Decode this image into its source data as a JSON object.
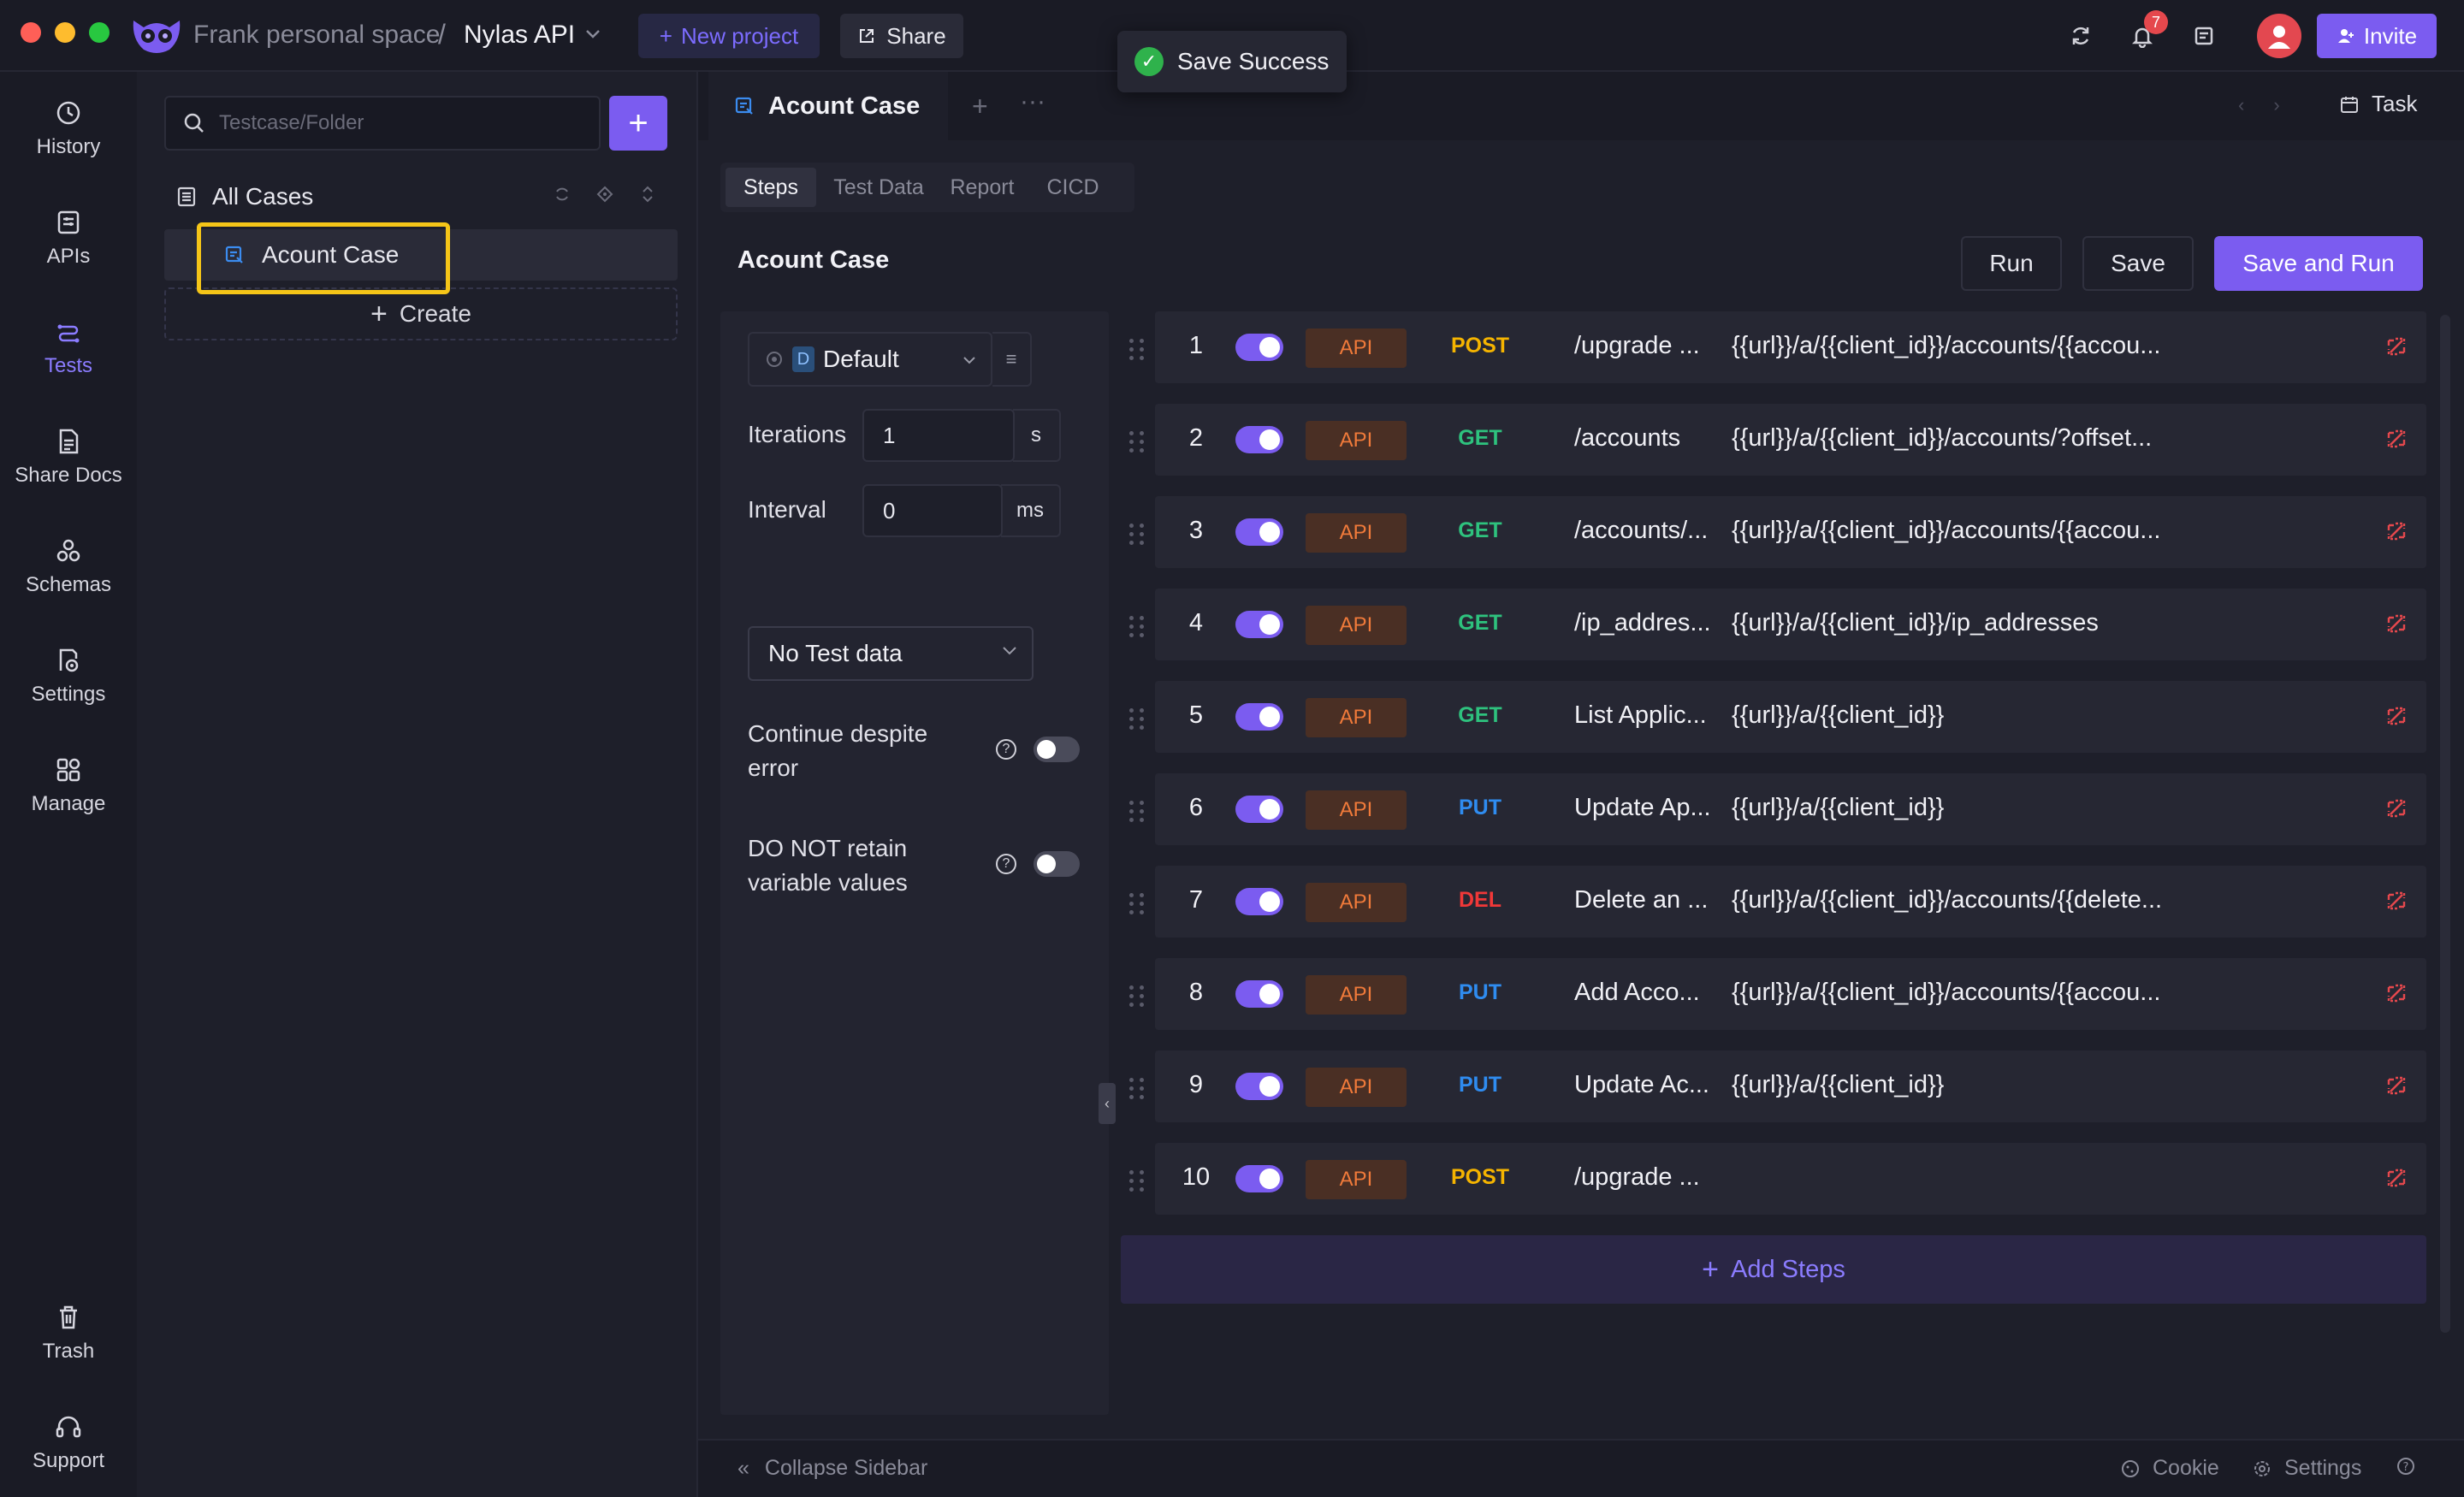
{
  "topbar": {
    "workspace": "Frank personal space",
    "separator": "/",
    "project": "Nylas API",
    "new_project": "New project",
    "share": "Share",
    "toast": "Save Success",
    "notification_count": "7",
    "invite": "Invite"
  },
  "nav": {
    "items": [
      {
        "label": "History",
        "icon": "history-icon"
      },
      {
        "label": "APIs",
        "icon": "apis-icon"
      },
      {
        "label": "Tests",
        "icon": "tests-icon"
      },
      {
        "label": "Share Docs",
        "icon": "share-docs-icon"
      },
      {
        "label": "Schemas",
        "icon": "schemas-icon"
      },
      {
        "label": "Settings",
        "icon": "settings-icon"
      },
      {
        "label": "Manage",
        "icon": "manage-icon"
      }
    ],
    "trash": "Trash",
    "support": "Support"
  },
  "cases": {
    "search_placeholder": "Testcase/Folder",
    "all_cases": "All Cases",
    "case_name": "Acount Case",
    "create": "Create"
  },
  "main": {
    "tab_title": "Acount Case",
    "task": "Task",
    "subtabs": [
      "Steps",
      "Test Data",
      "Report",
      "CICD"
    ],
    "title": "Acount Case",
    "run": "Run",
    "save": "Save",
    "save_and_run": "Save and Run",
    "settings": {
      "environment": "Default",
      "environment_badge": "D",
      "iterations_label": "Iterations",
      "iterations_value": "1",
      "iterations_unit": "s",
      "interval_label": "Interval",
      "interval_value": "0",
      "interval_unit": "ms",
      "test_data": "No Test data",
      "continue_label": "Continue despite error",
      "retain_label": "DO NOT retain variable values"
    },
    "steps": [
      {
        "num": "1",
        "badge": "API",
        "method": "POST",
        "name": "/upgrade ...",
        "url": "{{url}}/a/{{client_id}}/accounts/{{accou..."
      },
      {
        "num": "2",
        "badge": "API",
        "method": "GET",
        "name": "/accounts",
        "url": "{{url}}/a/{{client_id}}/accounts/?offset..."
      },
      {
        "num": "3",
        "badge": "API",
        "method": "GET",
        "name": "/accounts/...",
        "url": "{{url}}/a/{{client_id}}/accounts/{{accou..."
      },
      {
        "num": "4",
        "badge": "API",
        "method": "GET",
        "name": "/ip_addres...",
        "url": "{{url}}/a/{{client_id}}/ip_addresses"
      },
      {
        "num": "5",
        "badge": "API",
        "method": "GET",
        "name": "List Applic...",
        "url": "{{url}}/a/{{client_id}}"
      },
      {
        "num": "6",
        "badge": "API",
        "method": "PUT",
        "name": "Update Ap...",
        "url": "{{url}}/a/{{client_id}}"
      },
      {
        "num": "7",
        "badge": "API",
        "method": "DEL",
        "name": "Delete an ...",
        "url": "{{url}}/a/{{client_id}}/accounts/{{delete..."
      },
      {
        "num": "8",
        "badge": "API",
        "method": "PUT",
        "name": "Add Acco...",
        "url": "{{url}}/a/{{client_id}}/accounts/{{accou..."
      },
      {
        "num": "9",
        "badge": "API",
        "method": "PUT",
        "name": "Update Ac...",
        "url": "{{url}}/a/{{client_id}}"
      },
      {
        "num": "10",
        "badge": "API",
        "method": "POST",
        "name": "/upgrade ...",
        "url": ""
      }
    ],
    "add_steps": "Add Steps"
  },
  "footer": {
    "collapse": "Collapse Sidebar",
    "cookie": "Cookie",
    "settings": "Settings"
  },
  "colors": {
    "accent": "#7b5cf0",
    "post": "#f5b400",
    "get": "#2ec27e",
    "put": "#2f8cf0",
    "del": "#f03838",
    "highlight": "#f5c518"
  }
}
